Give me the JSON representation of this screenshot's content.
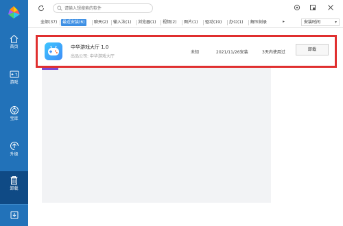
{
  "colors": {
    "sidebar": "#2272b9",
    "sidebar_active": "#0f4a85",
    "tab_active": "#3d8fe4",
    "highlight": "#e02f2f"
  },
  "search": {
    "placeholder": "请输入想搜索的软件",
    "value": ""
  },
  "sidebar": {
    "items": [
      {
        "label": "首页",
        "icon": "home-icon"
      },
      {
        "label": "游戏",
        "icon": "gamepad-icon"
      },
      {
        "label": "宝库",
        "icon": "treasure-icon"
      },
      {
        "label": "升级",
        "icon": "upgrade-icon"
      },
      {
        "label": "卸载",
        "icon": "trash-icon"
      }
    ],
    "bottom_icon": "download-icon"
  },
  "tabs": [
    {
      "label": "全部(37)"
    },
    {
      "label": "最近安装(6)"
    },
    {
      "label": "聊天(2)"
    },
    {
      "label": "输入法(1)"
    },
    {
      "label": "浏览器(1)"
    },
    {
      "label": "视频(2)"
    },
    {
      "label": "图片(1)"
    },
    {
      "label": "驱动(19)"
    },
    {
      "label": "办公(1)"
    },
    {
      "label": "解压刻录"
    }
  ],
  "tab_more": "▸",
  "sort": {
    "label": "安装时间",
    "icon": "chevron-down-icon"
  },
  "app": {
    "name": "中华游戏大厅 1.0",
    "publisher": "出品公司: 中华游戏大厅",
    "size": "未知",
    "date": "2021/11/26安装",
    "usage": "3天内使用过",
    "uninstall_label": "卸载",
    "icon": "game-controller-icon"
  }
}
